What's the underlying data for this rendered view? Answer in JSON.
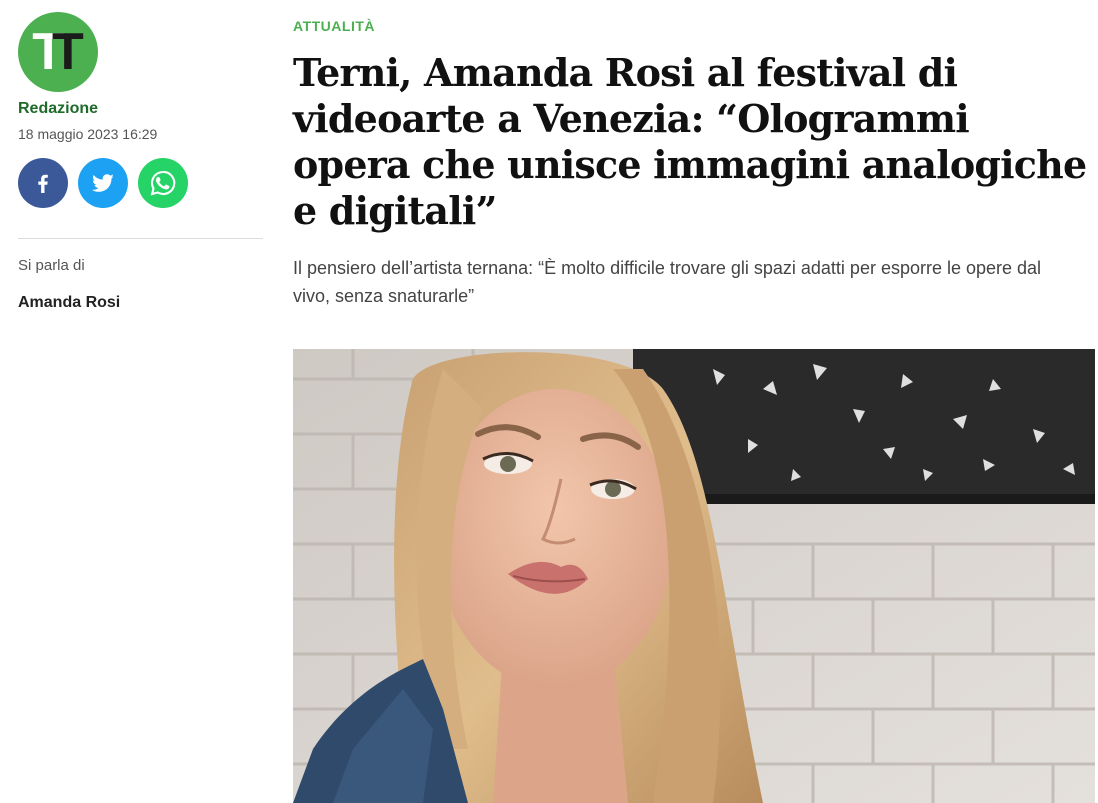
{
  "sidebar": {
    "logo_text": "TT",
    "author": "Redazione",
    "date": "18 maggio 2023 16:29",
    "share": [
      {
        "name": "facebook",
        "icon": "facebook-icon",
        "color": "#3b5998"
      },
      {
        "name": "twitter",
        "icon": "twitter-icon",
        "color": "#1da1f2"
      },
      {
        "name": "whatsapp",
        "icon": "whatsapp-icon",
        "color": "#25d366"
      }
    ],
    "tags_label": "Si parla di",
    "tags": [
      "Amanda Rosi"
    ]
  },
  "article": {
    "category": "ATTUALITÀ",
    "title": "Terni, Amanda Rosi al festival di videoarte a Venezia: “Ologrammi opera che unisce immagini analogiche e digitali”",
    "subtitle": "Il pensiero dell’artista ternana: “È molto difficile trovare gli spazi adatti per esporre le opere dal vivo, senza snaturarle”"
  },
  "colors": {
    "brand_green": "#4caf50",
    "author_green": "#1f6b2a"
  }
}
